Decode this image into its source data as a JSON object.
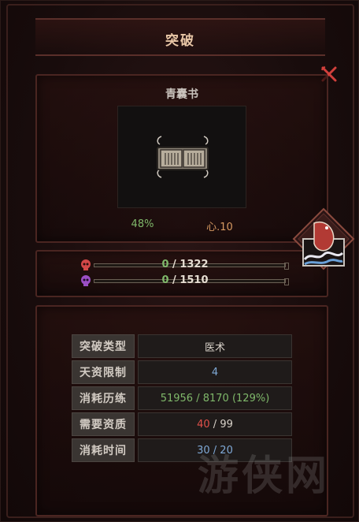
{
  "dialog": {
    "title": "突破"
  },
  "book": {
    "name": "青囊书",
    "progress_text": "48%",
    "attribute_text": "心.10"
  },
  "bars": [
    {
      "icon": "red-skull-icon",
      "current": "0",
      "separator": "/",
      "total": "1322",
      "color": "#d24848"
    },
    {
      "icon": "purple-skull-icon",
      "current": "0",
      "separator": "/",
      "total": "1510",
      "color": "#9a4fc4"
    }
  ],
  "details": {
    "rows": [
      {
        "label": "突破类型",
        "value": "医术"
      },
      {
        "label": "天资限制",
        "value": "4"
      },
      {
        "label": "消耗历练",
        "value_main": "51956",
        "value_sep": " / 8170 ",
        "value_pct": "(129%)"
      },
      {
        "label": "需要资质",
        "value_need": "40",
        "value_rest": " / 99"
      },
      {
        "label": "消耗时间",
        "value": "30 / 20"
      }
    ]
  },
  "watermark": "游侠网",
  "colors": {
    "accent": "#e8c6a6",
    "close": "#d2403c",
    "border": "#4a2521"
  }
}
